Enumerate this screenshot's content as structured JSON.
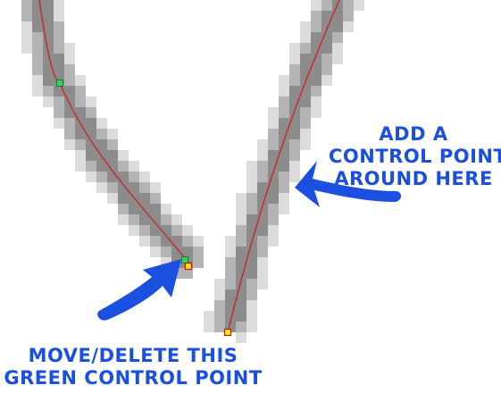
{
  "annotations": {
    "add_point": {
      "lines": [
        "ADD A",
        "CONTROL POINT",
        "AROUND HERE"
      ],
      "color": "#1a4fe0"
    },
    "move_point": {
      "lines": [
        "MOVE/DELETE THIS",
        "GREEN CONTROL POINT"
      ],
      "color": "#1a4fe0"
    }
  },
  "colors": {
    "pixel_light": "#dcdcdc",
    "pixel_mid": "#b4b4b4",
    "pixel_dark": "#8c8c8c",
    "curve": "#cc1f1f",
    "green_point": "#2fd35a",
    "green_point_border": "#1b7d2c",
    "yellow_point": "#ffe800",
    "yellow_point_border": "#c01818",
    "arrow": "#1a4fe0"
  },
  "control_points": [
    {
      "name": "green-control-point-upper",
      "kind": "green"
    },
    {
      "name": "green-control-point-lower",
      "kind": "green"
    },
    {
      "name": "yellow-end-point-left",
      "kind": "yellow"
    },
    {
      "name": "yellow-end-point-bottom",
      "kind": "yellow"
    }
  ]
}
